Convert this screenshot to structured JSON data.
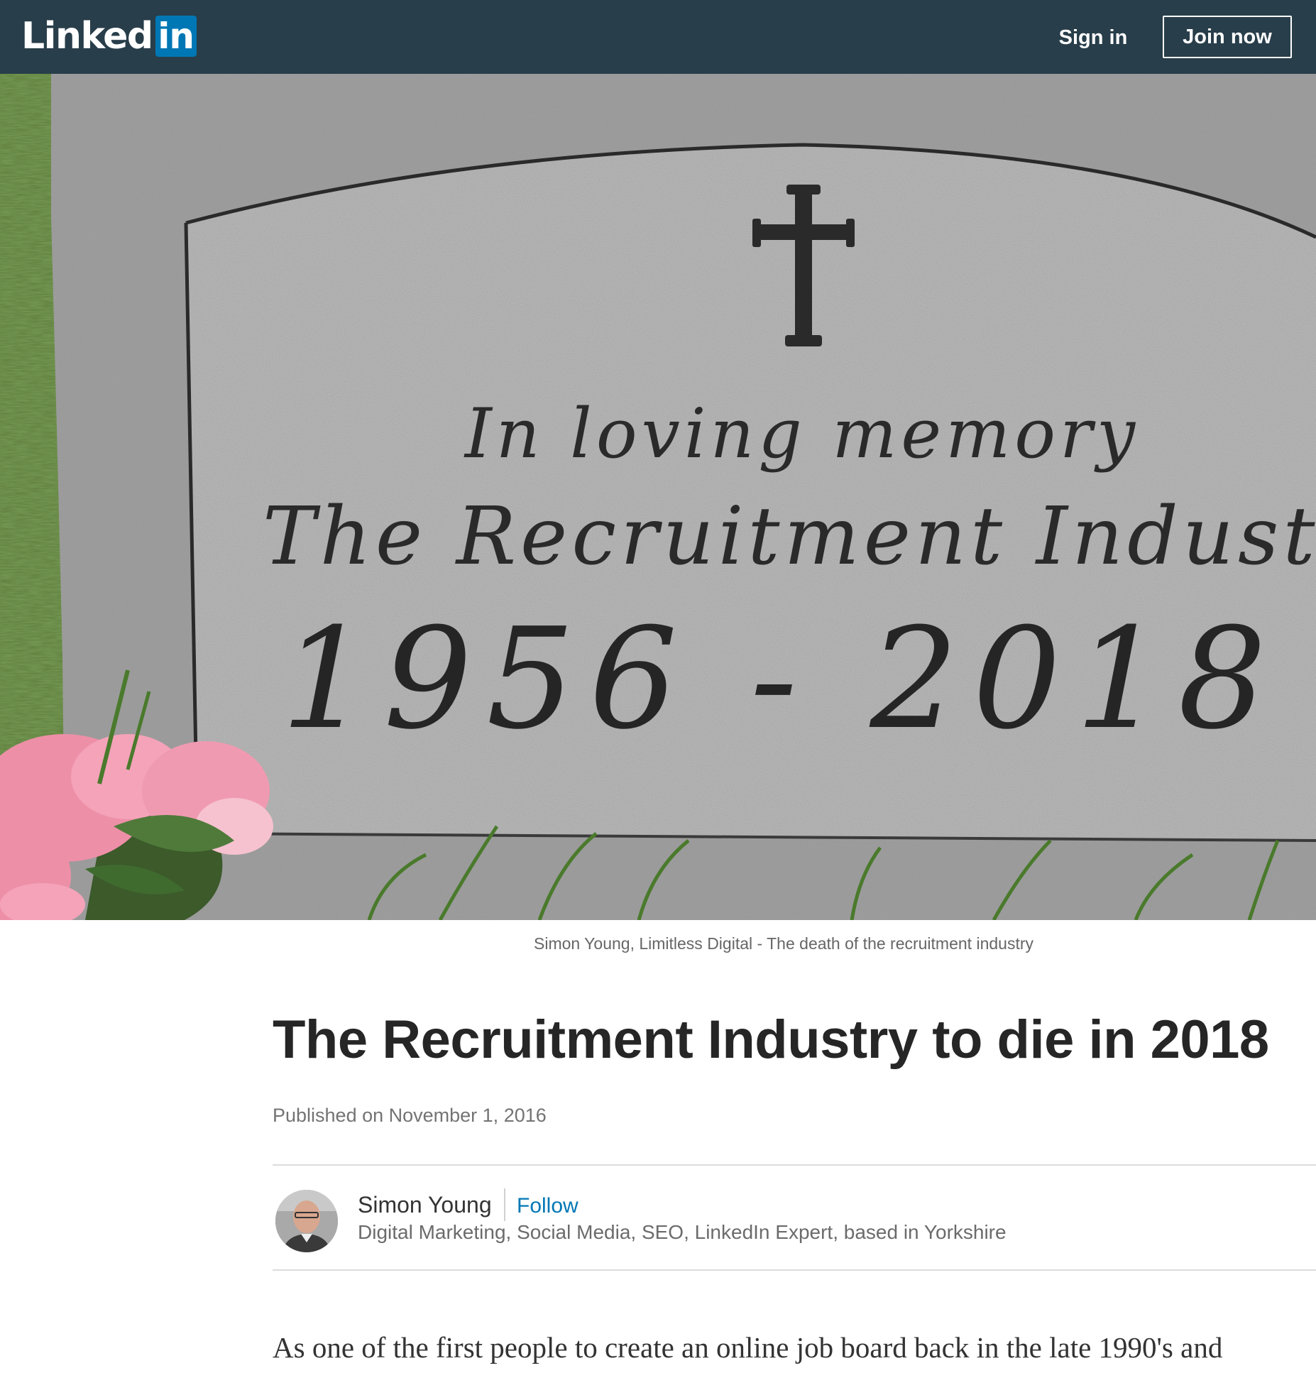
{
  "header": {
    "logo_word": "Linked",
    "logo_box": "in",
    "sign_in": "Sign in",
    "join_now": "Join now",
    "background_color": "#283e4a",
    "brand_color": "#0077b5"
  },
  "hero": {
    "inscription_line1": "In loving memory",
    "inscription_line2": "The Recruitment Industry",
    "inscription_years": "1956 - 2018",
    "icon": "cross-icon"
  },
  "caption": "Simon Young, Limitless Digital - The death of the recruitment industry",
  "article": {
    "title": "The Recruitment Industry to die in 2018",
    "published": "Published on November 1, 2016",
    "body_first_line": "As one of the first people to create an online job board back in the late 1990's and"
  },
  "author": {
    "name": "Simon Young",
    "follow": "Follow",
    "headline": "Digital Marketing, Social Media, SEO, LinkedIn Expert, based in Yorkshire",
    "follow_color": "#0077b5"
  }
}
